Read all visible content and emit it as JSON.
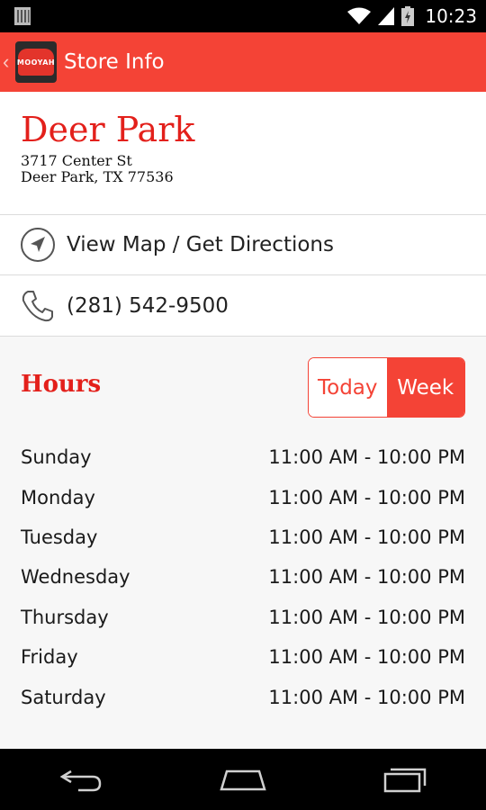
{
  "status_bar": {
    "time": "10:23",
    "icons": [
      "notification-icon",
      "wifi-icon",
      "signal-icon",
      "battery-icon"
    ]
  },
  "action_bar": {
    "title": "Store Info",
    "logo_text": "MOOYAH",
    "icons": [
      "back-chevron-icon",
      "app-logo"
    ]
  },
  "store": {
    "name": "Deer Park",
    "address_line1": "3717 Center St",
    "address_line2": "Deer Park, TX 77536"
  },
  "actions": {
    "directions_label": "View Map / Get Directions",
    "phone_label": "(281) 542-9500"
  },
  "hours": {
    "title": "Hours",
    "toggle": {
      "today_label": "Today",
      "week_label": "Week",
      "selected": "Week"
    },
    "days": [
      {
        "day": "Sunday",
        "time": "11:00 AM - 10:00 PM"
      },
      {
        "day": "Monday",
        "time": "11:00 AM - 10:00 PM"
      },
      {
        "day": "Tuesday",
        "time": "11:00 AM - 10:00 PM"
      },
      {
        "day": "Wednesday",
        "time": "11:00 AM - 10:00 PM"
      },
      {
        "day": "Thursday",
        "time": "11:00 AM - 10:00 PM"
      },
      {
        "day": "Friday",
        "time": "11:00 AM - 10:00 PM"
      },
      {
        "day": "Saturday",
        "time": "11:00 AM - 10:00 PM"
      }
    ]
  },
  "nav_bar": {
    "icons": [
      "back-icon",
      "home-icon",
      "recents-icon"
    ]
  },
  "colors": {
    "accent": "#f44336",
    "heading_red": "#e3201b"
  }
}
